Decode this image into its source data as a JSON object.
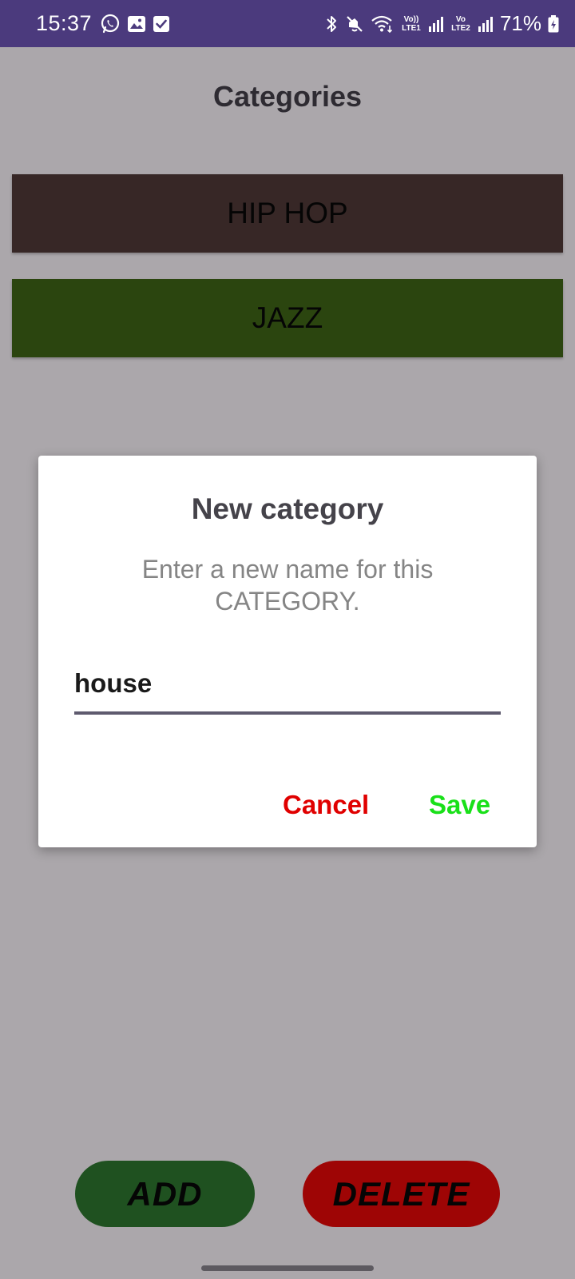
{
  "status_bar": {
    "time": "15:37",
    "battery": "71%",
    "background": "#4b3a7d",
    "left_icons": [
      "whatsapp-icon",
      "gallery-icon",
      "checkbox-icon"
    ],
    "right_icons": [
      "bluetooth-icon",
      "mute-icon",
      "wifi-icon",
      "volte-lte1-icon",
      "signal-icon",
      "volte-lte2-icon",
      "signal-icon",
      "battery-charging-icon"
    ],
    "volte1_label": "Vo)) LTE1",
    "volte2_label": "Vo LTE2"
  },
  "page": {
    "title": "Categories",
    "background": "#aba7ab"
  },
  "categories": [
    {
      "label": "HIP HOP",
      "color": "#372726"
    },
    {
      "label": "JAZZ",
      "color": "#2b450f"
    }
  ],
  "dialog": {
    "title": "New category",
    "message": "Enter a new name for this CATEGORY.",
    "input_value": "house",
    "cancel_label": "Cancel",
    "save_label": "Save",
    "cancel_color": "#e00000",
    "save_color": "#19e019"
  },
  "buttons": {
    "add_label": "ADD",
    "delete_label": "DELETE",
    "add_color": "#1f5120",
    "delete_color": "#9e0505"
  }
}
